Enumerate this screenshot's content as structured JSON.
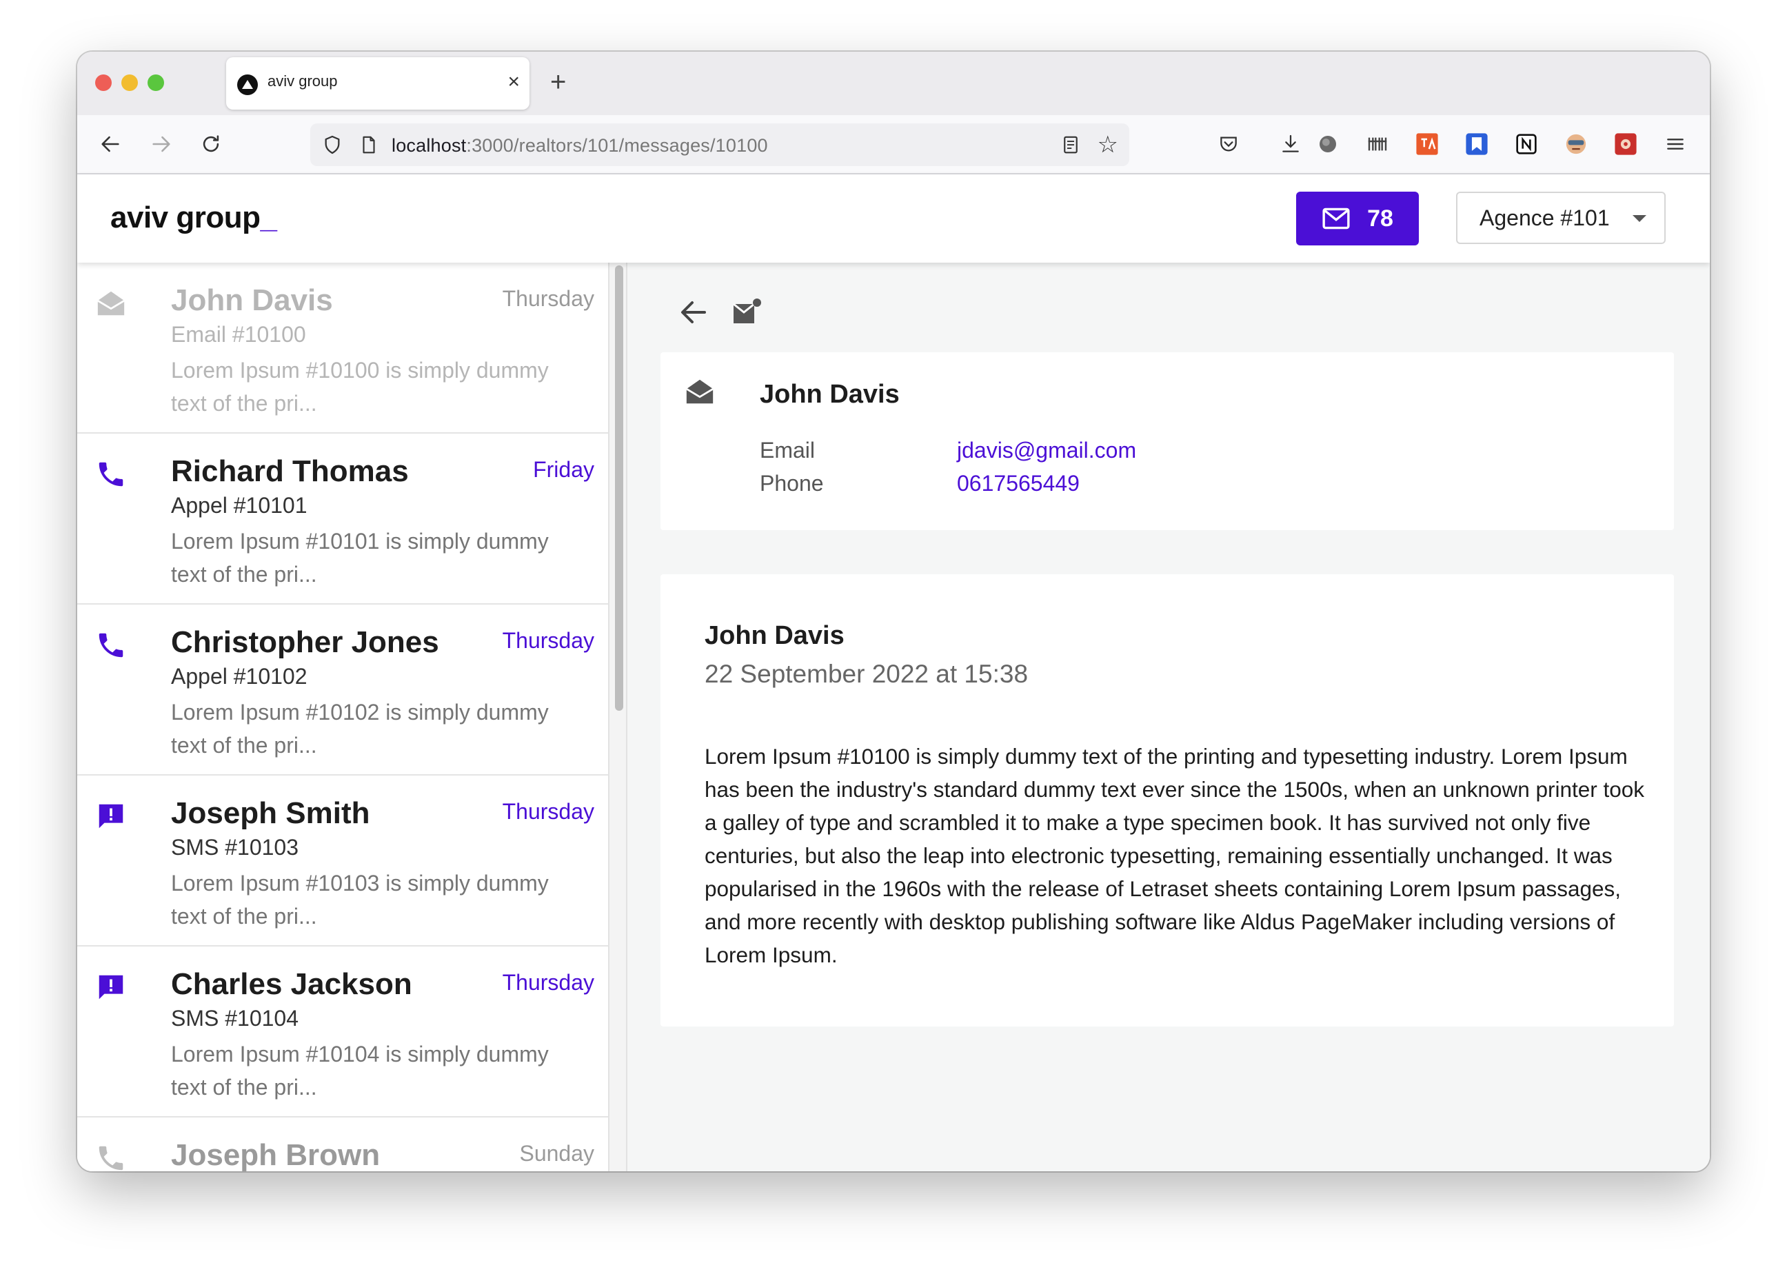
{
  "browser": {
    "tab_title": "aviv group",
    "url_host": "localhost",
    "url_path": ":3000/realtors/101/messages/10100"
  },
  "header": {
    "logo": "aviv group",
    "logo_cursor": "_",
    "unread_count": "78",
    "agency_select": "Agence #101"
  },
  "colors": {
    "accent": "#4b0fd6",
    "read_text": "#b5b5b5"
  },
  "messages": [
    {
      "icon": "email-read-icon",
      "name": "John Davis",
      "day": "Thursday",
      "subject": "Email #10100",
      "preview": "Lorem Ipsum #10100 is simply dummy text of the pri...",
      "read": true
    },
    {
      "icon": "phone-icon",
      "name": "Richard Thomas",
      "day": "Friday",
      "subject": "Appel #10101",
      "preview": "Lorem Ipsum #10101 is simply dummy text of the pri...",
      "read": false
    },
    {
      "icon": "phone-icon",
      "name": "Christopher Jones",
      "day": "Thursday",
      "subject": "Appel #10102",
      "preview": "Lorem Ipsum #10102 is simply dummy text of the pri...",
      "read": false
    },
    {
      "icon": "sms-icon",
      "name": "Joseph Smith",
      "day": "Thursday",
      "subject": "SMS #10103",
      "preview": "Lorem Ipsum #10103 is simply dummy text of the pri...",
      "read": false
    },
    {
      "icon": "sms-icon",
      "name": "Charles Jackson",
      "day": "Thursday",
      "subject": "SMS #10104",
      "preview": "Lorem Ipsum #10104 is simply dummy text of the pri...",
      "read": false
    },
    {
      "icon": "phone-icon",
      "name": "Joseph Brown",
      "day": "Sunday",
      "subject": "",
      "preview": "",
      "read": true
    }
  ],
  "contact": {
    "name": "John Davis",
    "email_label": "Email",
    "email": "jdavis@gmail.com",
    "phone_label": "Phone",
    "phone": "0617565449"
  },
  "message": {
    "sender": "John Davis",
    "date": "22 September 2022 at 15:38",
    "body": "Lorem Ipsum #10100 is simply dummy text of the printing and typesetting industry. Lorem Ipsum has been the industry's standard dummy text ever since the 1500s, when an unknown printer took a galley of type and scrambled it to make a type specimen book. It has survived not only five centuries, but also the leap into electronic typesetting, remaining essentially unchanged. It was popularised in the 1960s with the release of Letraset sheets containing Lorem Ipsum passages, and more recently with desktop publishing software like Aldus PageMaker including versions of Lorem Ipsum."
  }
}
